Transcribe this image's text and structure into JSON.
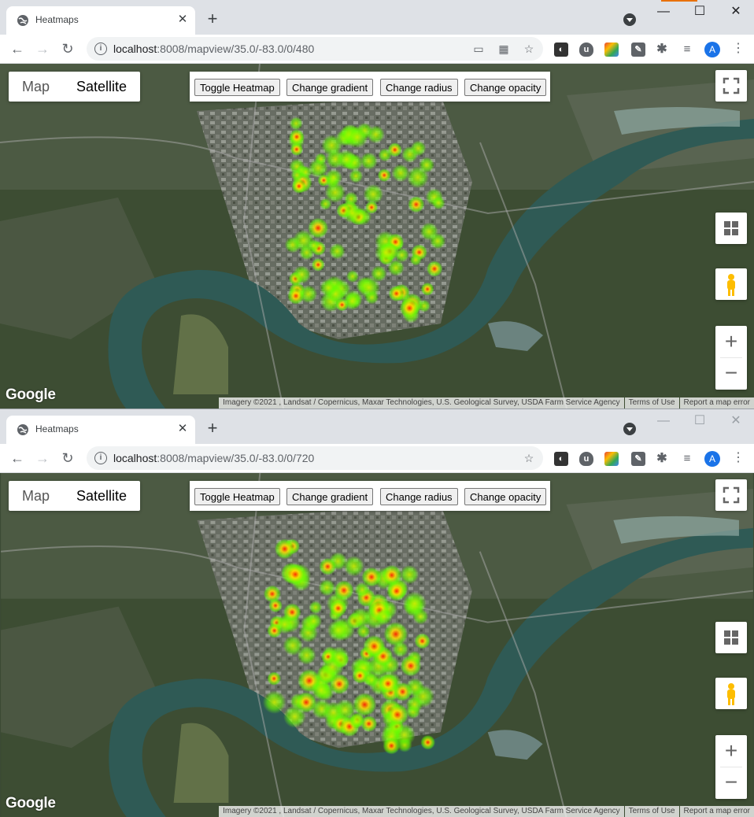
{
  "windows": [
    {
      "tab": {
        "title": "Heatmaps",
        "close": "✕"
      },
      "url": {
        "host": "localhost",
        "rest": ":8008/mapview/35.0/-83.0/0/480"
      },
      "map": {
        "type_map": "Map",
        "type_satellite": "Satellite",
        "buttons": {
          "toggle": "Toggle Heatmap",
          "gradient": "Change gradient",
          "radius": "Change radius",
          "opacity": "Change opacity"
        },
        "zoom_in": "+",
        "zoom_out": "−",
        "logo": "Google",
        "attribution": "Imagery ©2021 , Landsat / Copernicus, Maxar Technologies, U.S. Geological Survey, USDA Farm Service Agency",
        "terms": "Terms of Use",
        "report": "Report a map error"
      }
    },
    {
      "tab": {
        "title": "Heatmaps",
        "close": "✕"
      },
      "url": {
        "host": "localhost",
        "rest": ":8008/mapview/35.0/-83.0/0/720"
      },
      "map": {
        "type_map": "Map",
        "type_satellite": "Satellite",
        "buttons": {
          "toggle": "Toggle Heatmap",
          "gradient": "Change gradient",
          "radius": "Change radius",
          "opacity": "Change opacity"
        },
        "zoom_in": "+",
        "zoom_out": "−",
        "logo": "Google",
        "attribution": "Imagery ©2021 , Landsat / Copernicus, Maxar Technologies, U.S. Geological Survey, USDA Farm Service Agency",
        "terms": "Terms of Use",
        "report": "Report a map error"
      }
    }
  ],
  "icons": {
    "favicon": "globe-icon",
    "new_tab": "plus-icon",
    "tab_search": "chevron-down-icon",
    "minimize": "minimize-icon",
    "maximize": "maximize-icon",
    "close_window": "close-icon",
    "back": "arrow-left-icon",
    "forward": "arrow-right-icon",
    "reload": "reload-icon",
    "site_info": "info-icon",
    "bookmark": "star-icon",
    "fullscreen": "fullscreen-icon",
    "layers": "layers-icon",
    "pegman": "pegman-icon"
  },
  "colors": {
    "heat_low": "#66ff00",
    "heat_mid": "#ffdd00",
    "heat_high": "#ff2200",
    "river": "#2f5a55",
    "avatar": "#1a73e8",
    "accent": "#e8710a"
  }
}
